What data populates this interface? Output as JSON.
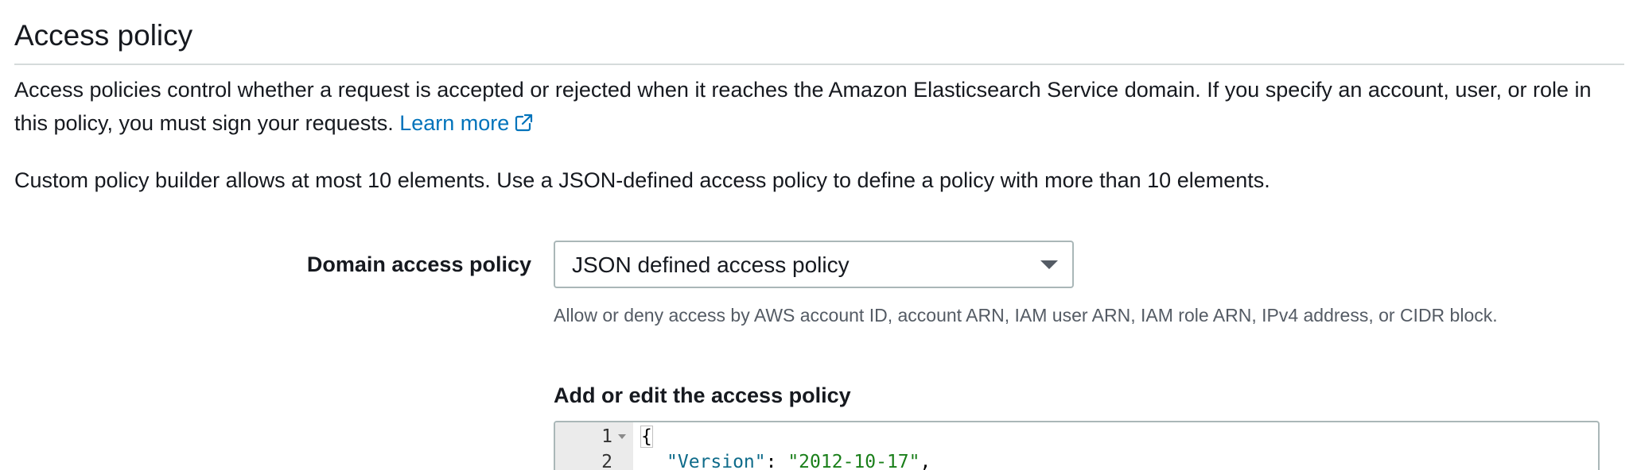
{
  "section": {
    "title": "Access policy",
    "description": "Access policies control whether a request is accepted or rejected when it reaches the Amazon Elasticsearch Service domain. If you specify an account, user, or role in this policy, you must sign your requests.",
    "learn_more_label": "Learn more",
    "learn_more_icon": "external-link-icon",
    "builder_note": "Custom policy builder allows at most 10 elements. Use a JSON-defined access policy to define a policy with more than 10 elements."
  },
  "domain_access_policy": {
    "label": "Domain access policy",
    "selected": "JSON defined access policy",
    "hint": "Allow or deny access by AWS account ID, account ARN, IAM user ARN, IAM role ARN, IPv4 address, or CIDR block."
  },
  "editor": {
    "title": "Add or edit the access policy",
    "lines": [
      {
        "number": "1",
        "open_brace": "{"
      },
      {
        "number": "2",
        "key": "\"Version\"",
        "separator": ": ",
        "value": "\"2012-10-17\"",
        "trailing": ","
      }
    ]
  },
  "colors": {
    "link": "#0073bb",
    "text": "#16191f",
    "muted": "#545b64",
    "border": "#aab7b8",
    "json_key": "#0e6b8a",
    "json_string": "#1a7f1a"
  }
}
